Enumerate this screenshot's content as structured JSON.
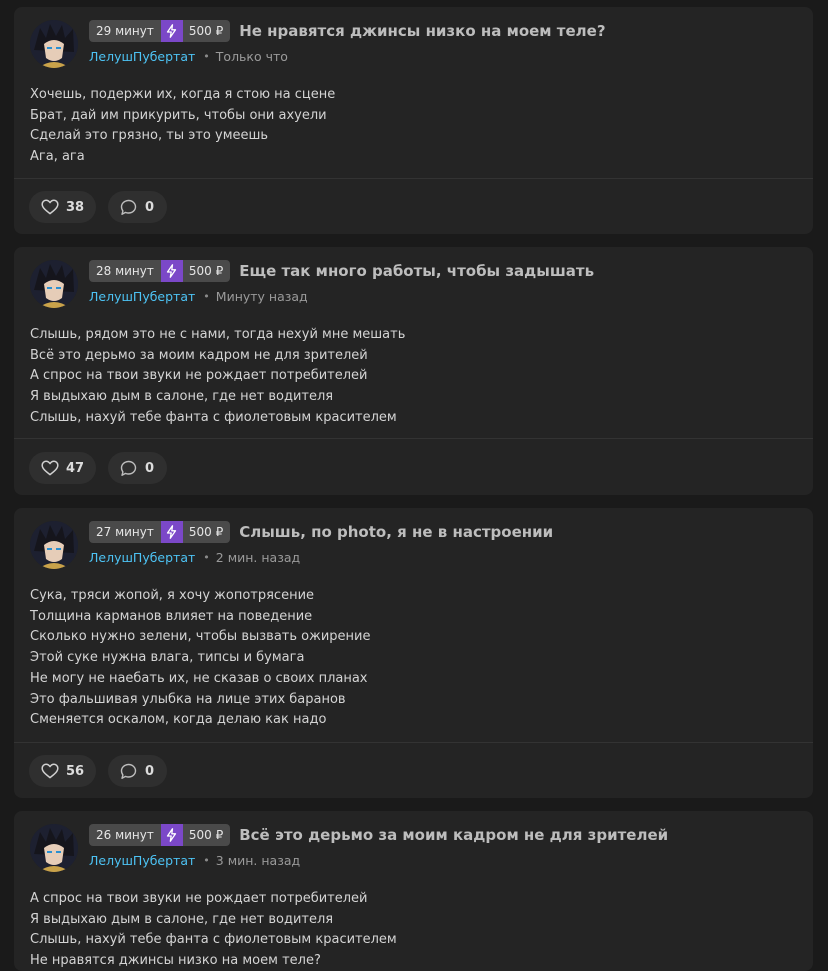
{
  "posts": [
    {
      "time": "29 минут",
      "price": "500 ₽",
      "title": "Не нравятся джинсы низко на моем теле?",
      "author": "ЛелушПубертат",
      "when": "Только что",
      "lines": [
        "Хочешь, подержи их, когда я стою на сцене",
        "Брат, дай им прикурить, чтобы они ахуели",
        "Сделай это грязно, ты это умеешь",
        "Ага, ага"
      ],
      "likes": "38",
      "comments": "0"
    },
    {
      "time": "28 минут",
      "price": "500 ₽",
      "title": "Еще так много работы, чтобы задышать",
      "author": "ЛелушПубертат",
      "when": "Минуту назад",
      "lines": [
        "Слышь, рядом это не с нами, тогда нехуй мне мешать",
        "Всё это дерьмо за моим кадром не для зрителей",
        "А спрос на твои звуки не рождает потребителей",
        "Я выдыхаю дым в салоне, где нет водителя",
        "Слышь, нахуй тебе фанта с фиолетовым красителем"
      ],
      "likes": "47",
      "comments": "0"
    },
    {
      "time": "27 минут",
      "price": "500 ₽",
      "title": "Слышь, по photo, я не в настроении",
      "author": "ЛелушПубертат",
      "when": "2 мин. назад",
      "lines": [
        "Сука, тряси жопой, я хочу жопотрясение",
        "Толщина карманов влияет на поведение",
        "Сколько нужно зелени, чтобы вызвать ожирение",
        "Этой суке нужна влага, типсы и бумага",
        "Не могу не наебать их, не сказав о своих планах",
        "Это фальшивая улыбка на лице этих баранов",
        "Сменяется оскалом, когда делаю как надо"
      ],
      "likes": "56",
      "comments": "0"
    },
    {
      "time": "26 минут",
      "price": "500 ₽",
      "title": "Всё это дерьмо за моим кадром не для зрителей",
      "author": "ЛелушПубертат",
      "when": "3 мин. назад",
      "lines": [
        "А спрос на твои звуки не рождает потребителей",
        "Я выдыхаю дым в салоне, где нет водителя",
        "Слышь, нахуй тебе фанта с фиолетовым красителем",
        "Не нравятся джинсы низко на моем теле?"
      ]
    }
  ],
  "colors": {
    "background": "#1a1a1a",
    "card": "#242424",
    "author": "#4dc3f4",
    "boost": "#7b48c8"
  },
  "icons": {
    "boost": "lightning-icon",
    "like": "heart-icon",
    "comment": "comment-bubble-icon"
  }
}
